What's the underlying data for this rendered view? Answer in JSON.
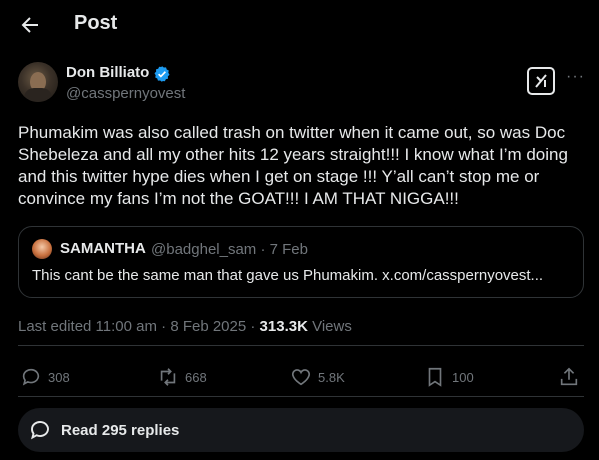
{
  "header": {
    "title": "Post",
    "back_icon": "arrow-left-icon"
  },
  "author": {
    "name": "Don Billiato",
    "handle": "@casspernyovest",
    "verified": true,
    "verified_color": "#1d9bf0"
  },
  "tweet": {
    "text": "Phumakim was also called trash on twitter when it came out, so was Doc Shebeleza and all my other hits 12 years straight!!! I know what I’m doing and this twitter hype dies when I get on stage !!! Y’all can’t stop me or convince my fans I’m not the GOAT!!! I AM THAT NIGGA!!!"
  },
  "quote": {
    "name": "SAMANTHA",
    "handle_date": "@badghel_sam · 7 Feb",
    "text": "This cant  be the same man that gave us Phumakim. x.com/casspernyovest..."
  },
  "meta": {
    "edited": "Last edited 11:00 am · 8 Feb 2025 · ",
    "views_count": "313.3K",
    "views_label": " Views"
  },
  "actions": {
    "replies": "308",
    "reposts": "668",
    "likes": "5.8K",
    "bookmarks": "100"
  },
  "read_replies": "Read 295 replies",
  "colors": {
    "background": "#000000",
    "text": "#e7e9ea",
    "muted": "#71767b",
    "border": "#2f3336",
    "verified": "#1d9bf0"
  }
}
